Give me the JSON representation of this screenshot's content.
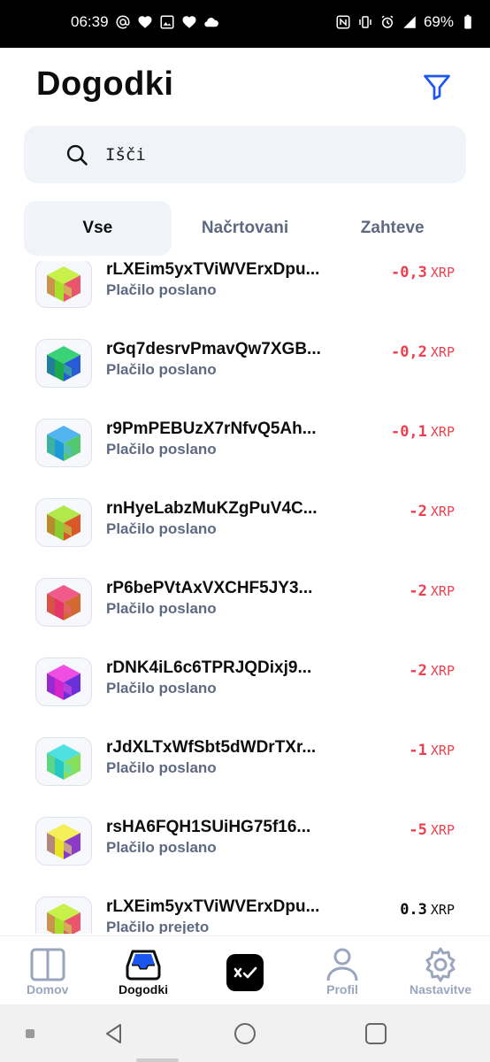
{
  "status": {
    "time": "06:39",
    "battery": "69%"
  },
  "header": {
    "title": "Dogodki"
  },
  "search": {
    "placeholder": "Išči"
  },
  "tabs": [
    {
      "label": "Vse",
      "active": true
    },
    {
      "label": "Načrtovani",
      "active": false
    },
    {
      "label": "Zahteve",
      "active": false
    }
  ],
  "events": [
    {
      "address": "rLXEim5yxTViWVErxDpu...",
      "subtitle": "Plačilo poslano",
      "amount": "-0,3",
      "currency": "XRP",
      "sign": "neg",
      "colors": [
        "#a6e02b",
        "#e8556c",
        "#c7f04a"
      ]
    },
    {
      "address": "rGq7desrvPmavQw7XGB...",
      "subtitle": "Plačilo poslano",
      "amount": "-0,2",
      "currency": "XRP",
      "sign": "neg",
      "colors": [
        "#1aa94f",
        "#2a5bd7",
        "#39d276"
      ]
    },
    {
      "address": "r9PmPEBUzX7rNfvQ5Ah...",
      "subtitle": "Plačilo poslano",
      "amount": "-0,1",
      "currency": "XRP",
      "sign": "neg",
      "colors": [
        "#1f9ad8",
        "#54c86f",
        "#53b5f0"
      ]
    },
    {
      "address": "rnHyeLabzMuKZgPuV4C...",
      "subtitle": "Plačilo poslano",
      "amount": "-2",
      "currency": "XRP",
      "sign": "neg",
      "colors": [
        "#8ccc2e",
        "#d9572b",
        "#b2e84a"
      ]
    },
    {
      "address": "rP6bePVtAxVXCHF5JY3...",
      "subtitle": "Plačilo poslano",
      "amount": "-2",
      "currency": "XRP",
      "sign": "neg",
      "colors": [
        "#e33567",
        "#d06a2f",
        "#f05b8c"
      ]
    },
    {
      "address": "rDNK4iL6c6TPRJQDixj9...",
      "subtitle": "Plačilo poslano",
      "amount": "-2",
      "currency": "XRP",
      "sign": "neg",
      "colors": [
        "#d325c9",
        "#6a30d9",
        "#f04ee2"
      ]
    },
    {
      "address": "rJdXLTxWfSbt5dWDrTXr...",
      "subtitle": "Plačilo poslano",
      "amount": "-1",
      "currency": "XRP",
      "sign": "neg",
      "colors": [
        "#25c7c2",
        "#88e05a",
        "#4fe0e0"
      ]
    },
    {
      "address": "rsHA6FQH1SUiHG75f16...",
      "subtitle": "Plačilo poslano",
      "amount": "-5",
      "currency": "XRP",
      "sign": "neg",
      "colors": [
        "#e8e323",
        "#8b3cc7",
        "#f5f05a"
      ]
    },
    {
      "address": "rLXEim5yxTViWVErxDpu...",
      "subtitle": "Plačilo prejeto",
      "amount": "0.3",
      "currency": "XRP",
      "sign": "pos",
      "colors": [
        "#a6e02b",
        "#e8556c",
        "#c7f04a"
      ]
    }
  ],
  "nav": [
    {
      "label": "Domov",
      "icon": "home-icon",
      "active": false
    },
    {
      "label": "Dogodki",
      "icon": "inbox-icon",
      "active": true
    },
    {
      "label": "Profil",
      "icon": "profile-icon",
      "active": false
    },
    {
      "label": "Nastavitve",
      "icon": "gear-icon",
      "active": false
    }
  ],
  "accent": "#1c56f0"
}
